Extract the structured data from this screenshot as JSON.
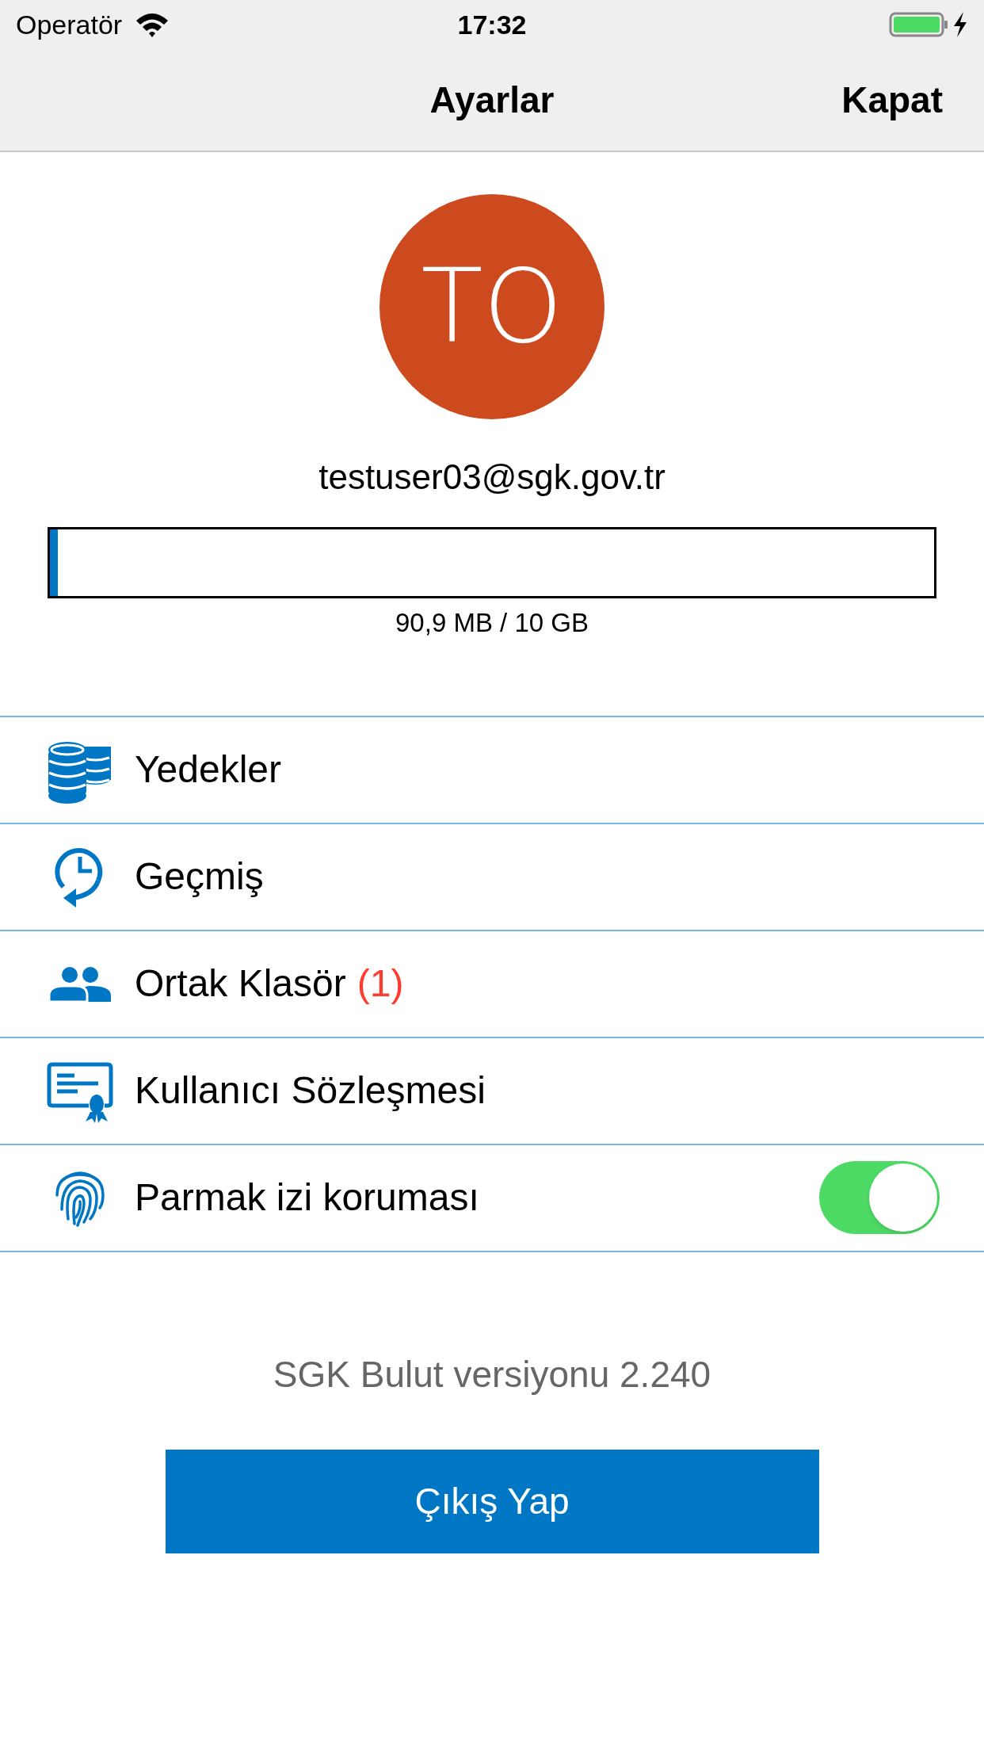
{
  "status_bar": {
    "carrier": "Operatör",
    "time": "17:32",
    "charging": true
  },
  "nav": {
    "title": "Ayarlar",
    "right_button": "Kapat"
  },
  "profile": {
    "initials": "TO",
    "email": "testuser03@sgk.gov.tr"
  },
  "storage": {
    "level": 0.009,
    "reading": "90,9 MB / 10 GB"
  },
  "menu": [
    {
      "kind": "link",
      "label": "Yedekler"
    },
    {
      "kind": "link",
      "label": "Geçmiş"
    },
    {
      "kind": "link",
      "label": "Ortak Klasör",
      "badge": "(1)"
    },
    {
      "kind": "link",
      "label": "Kullanıcı Sözleşmesi"
    },
    {
      "kind": "toggle",
      "label": "Parmak izi koruması",
      "on": true
    }
  ],
  "version": "SGK Bulut versiyonu 2.240",
  "logout_button": "Çıkış Yap"
}
